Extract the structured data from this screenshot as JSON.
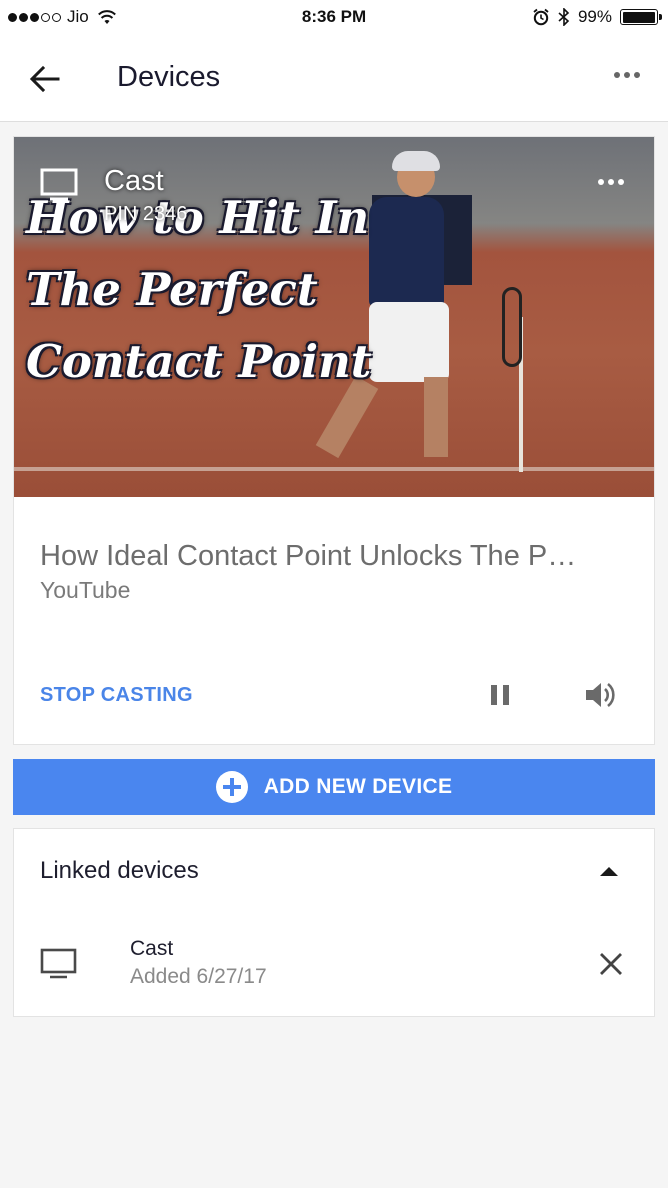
{
  "status_bar": {
    "carrier": "Jio",
    "time": "8:36 PM",
    "battery_percent": "99%",
    "battery_level": 0.99,
    "signal_bars_filled": 3,
    "signal_bars_total": 5
  },
  "app_bar": {
    "title": "Devices",
    "back_icon": "arrow-left-icon",
    "more_icon": "more-horizontal-icon"
  },
  "now_playing": {
    "device_name": "Cast",
    "pin": "PIN 2346",
    "thumbnail_text_lines": [
      "How to Hit In",
      "The Perfect",
      "Contact Point"
    ],
    "title": "How Ideal Contact Point Unlocks The P…",
    "source": "YouTube",
    "stop_casting_label": "STOP CASTING",
    "pause_icon": "pause-icon",
    "volume_icon": "volume-icon"
  },
  "add_device": {
    "label": "ADD NEW DEVICE",
    "icon": "plus-circle-icon",
    "color": "#4a86ef"
  },
  "linked_devices": {
    "title": "Linked devices",
    "collapse_icon": "chevron-up-icon",
    "items": [
      {
        "name": "Cast",
        "added": "Added 6/27/17",
        "icon": "tv-icon",
        "remove_icon": "close-icon"
      }
    ]
  },
  "colors": {
    "accent": "#4a85e8",
    "background": "#f5f5f5"
  }
}
